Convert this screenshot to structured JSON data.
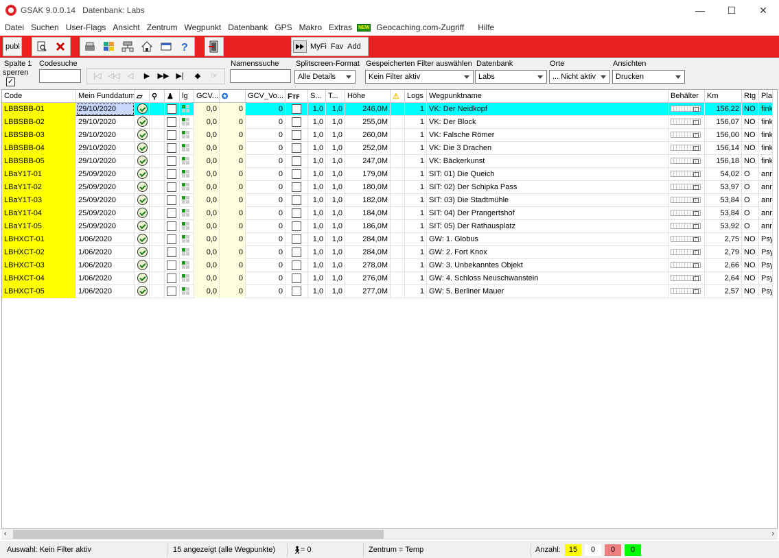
{
  "window": {
    "title": "GSAK 9.0.0.14",
    "db_label": "Datenbank: Labs",
    "minimize": "—",
    "maximize": "☐",
    "close": "✕"
  },
  "menu": [
    "Datei",
    "Suchen",
    "User-Flags",
    "Ansicht",
    "Zentrum",
    "Wegpunkt",
    "Datenbank",
    "GPS",
    "Makro",
    "Extras",
    "Geocaching.com-Zugriff",
    "Hilfe"
  ],
  "menu_new_badge": "NEW",
  "toolbar": {
    "publ": "publ",
    "myfi": "MyFi",
    "fav": "Fav",
    "add": "Add"
  },
  "filterbar": {
    "spalte_label": "Spalte 1",
    "sperren_label": "sperren",
    "codesuche_label": "Codesuche",
    "codesuche_value": "",
    "namenssuche_label": "Namenssuche",
    "namenssuche_value": "",
    "splitscreen_label": "Splitscreen-Format",
    "splitscreen_value": "Alle Details",
    "filter_label": "Gespeicherten Filter auswählen",
    "filter_value": "Kein Filter aktiv",
    "datenbank_label": "Datenbank",
    "datenbank_value": "Labs",
    "orte_label": "Orte",
    "orte_value": "... Nicht aktiv",
    "ansichten_label": "Ansichten",
    "ansichten_value": "Drucken"
  },
  "columns": [
    "Code",
    "Mein Funddatum",
    "",
    "",
    "",
    "lg",
    "GCV...",
    "",
    "GCV_Vo...",
    "",
    "S...",
    "T...",
    "Höhe",
    "",
    "Logs",
    "Wegpunktname",
    "Behälter",
    "Km",
    "Rtg",
    "Plat"
  ],
  "rows": [
    {
      "code": "LBBSBB-01",
      "date": "29/10/2020",
      "gcv": "0,0",
      "n1": "0",
      "gcvvo": "0",
      "s": "1,0",
      "t": "1,0",
      "hoehe": "246,0M",
      "logs": "1",
      "name": "VK: Der Neidkopf",
      "km": "156,22",
      "rtg": "NO",
      "plat": "fink"
    },
    {
      "code": "LBBSBB-02",
      "date": "29/10/2020",
      "gcv": "0,0",
      "n1": "0",
      "gcvvo": "0",
      "s": "1,0",
      "t": "1,0",
      "hoehe": "255,0M",
      "logs": "1",
      "name": "VK: Der Block",
      "km": "156,07",
      "rtg": "NO",
      "plat": "fink"
    },
    {
      "code": "LBBSBB-03",
      "date": "29/10/2020",
      "gcv": "0,0",
      "n1": "0",
      "gcvvo": "0",
      "s": "1,0",
      "t": "1,0",
      "hoehe": "260,0M",
      "logs": "1",
      "name": "VK: Falsche Römer",
      "km": "156,00",
      "rtg": "NO",
      "plat": "fink"
    },
    {
      "code": "LBBSBB-04",
      "date": "29/10/2020",
      "gcv": "0,0",
      "n1": "0",
      "gcvvo": "0",
      "s": "1,0",
      "t": "1,0",
      "hoehe": "252,0M",
      "logs": "1",
      "name": "VK: Die 3 Drachen",
      "km": "156,14",
      "rtg": "NO",
      "plat": "fink"
    },
    {
      "code": "LBBSBB-05",
      "date": "29/10/2020",
      "gcv": "0,0",
      "n1": "0",
      "gcvvo": "0",
      "s": "1,0",
      "t": "1,0",
      "hoehe": "247,0M",
      "logs": "1",
      "name": "VK: Bäckerkunst",
      "km": "156,18",
      "rtg": "NO",
      "plat": "fink"
    },
    {
      "code": "LBaY1T-01",
      "date": "25/09/2020",
      "gcv": "0,0",
      "n1": "0",
      "gcvvo": "0",
      "s": "1,0",
      "t": "1,0",
      "hoehe": "179,0M",
      "logs": "1",
      "name": "SIT: 01) Die Queich",
      "km": "54,02",
      "rtg": "O",
      "plat": "ann"
    },
    {
      "code": "LBaY1T-02",
      "date": "25/09/2020",
      "gcv": "0,0",
      "n1": "0",
      "gcvvo": "0",
      "s": "1,0",
      "t": "1,0",
      "hoehe": "180,0M",
      "logs": "1",
      "name": "SIT: 02) Der Schipka Pass",
      "km": "53,97",
      "rtg": "O",
      "plat": "ann"
    },
    {
      "code": "LBaY1T-03",
      "date": "25/09/2020",
      "gcv": "0,0",
      "n1": "0",
      "gcvvo": "0",
      "s": "1,0",
      "t": "1,0",
      "hoehe": "182,0M",
      "logs": "1",
      "name": "SIT: 03) Die Stadtmühle",
      "km": "53,84",
      "rtg": "O",
      "plat": "ann"
    },
    {
      "code": "LBaY1T-04",
      "date": "25/09/2020",
      "gcv": "0,0",
      "n1": "0",
      "gcvvo": "0",
      "s": "1,0",
      "t": "1,0",
      "hoehe": "184,0M",
      "logs": "1",
      "name": "SIT: 04) Der Prangertshof",
      "km": "53,84",
      "rtg": "O",
      "plat": "ann"
    },
    {
      "code": "LBaY1T-05",
      "date": "25/09/2020",
      "gcv": "0,0",
      "n1": "0",
      "gcvvo": "0",
      "s": "1,0",
      "t": "1,0",
      "hoehe": "186,0M",
      "logs": "1",
      "name": "SIT: 05) Der Rathausplatz",
      "km": "53,92",
      "rtg": "O",
      "plat": "ann"
    },
    {
      "code": "LBHXCT-01",
      "date": "1/06/2020",
      "gcv": "0,0",
      "n1": "0",
      "gcvvo": "0",
      "s": "1,0",
      "t": "1,0",
      "hoehe": "284,0M",
      "logs": "1",
      "name": "GW: 1. Globus",
      "km": "2,75",
      "rtg": "NO",
      "plat": "Psy"
    },
    {
      "code": "LBHXCT-02",
      "date": "1/06/2020",
      "gcv": "0,0",
      "n1": "0",
      "gcvvo": "0",
      "s": "1,0",
      "t": "1,0",
      "hoehe": "284,0M",
      "logs": "1",
      "name": "GW: 2. Fort Knox",
      "km": "2,79",
      "rtg": "NO",
      "plat": "Psy"
    },
    {
      "code": "LBHXCT-03",
      "date": "1/06/2020",
      "gcv": "0,0",
      "n1": "0",
      "gcvvo": "0",
      "s": "1,0",
      "t": "1,0",
      "hoehe": "278,0M",
      "logs": "1",
      "name": "GW: 3. Unbekanntes Objekt",
      "km": "2,66",
      "rtg": "NO",
      "plat": "Psy"
    },
    {
      "code": "LBHXCT-04",
      "date": "1/06/2020",
      "gcv": "0,0",
      "n1": "0",
      "gcvvo": "0",
      "s": "1,0",
      "t": "1,0",
      "hoehe": "276,0M",
      "logs": "1",
      "name": "GW: 4. Schloss Neuschwanstein",
      "km": "2,64",
      "rtg": "NO",
      "plat": "Psy"
    },
    {
      "code": "LBHXCT-05",
      "date": "1/06/2020",
      "gcv": "0,0",
      "n1": "0",
      "gcvvo": "0",
      "s": "1,0",
      "t": "1,0",
      "hoehe": "277,0M",
      "logs": "1",
      "name": "GW: 5. Berliner Mauer",
      "km": "2,57",
      "rtg": "NO",
      "plat": "Psy"
    }
  ],
  "status": {
    "auswahl": "Auswahl: Kein Filter aktiv",
    "angezeigt": "15 angezeigt (alle Wegpunkte)",
    "person": "= 0",
    "zentrum": "Zentrum = Temp",
    "anzahl_label": "Anzahl:",
    "count_yellow": "15",
    "count_white": "0",
    "count_red": "0",
    "count_green": "0"
  },
  "colors": {
    "toolbar": "#e82020",
    "code_cell": "#ffff00",
    "selected_row": "#00ffff",
    "gcv_cell": "#ffffe0"
  }
}
